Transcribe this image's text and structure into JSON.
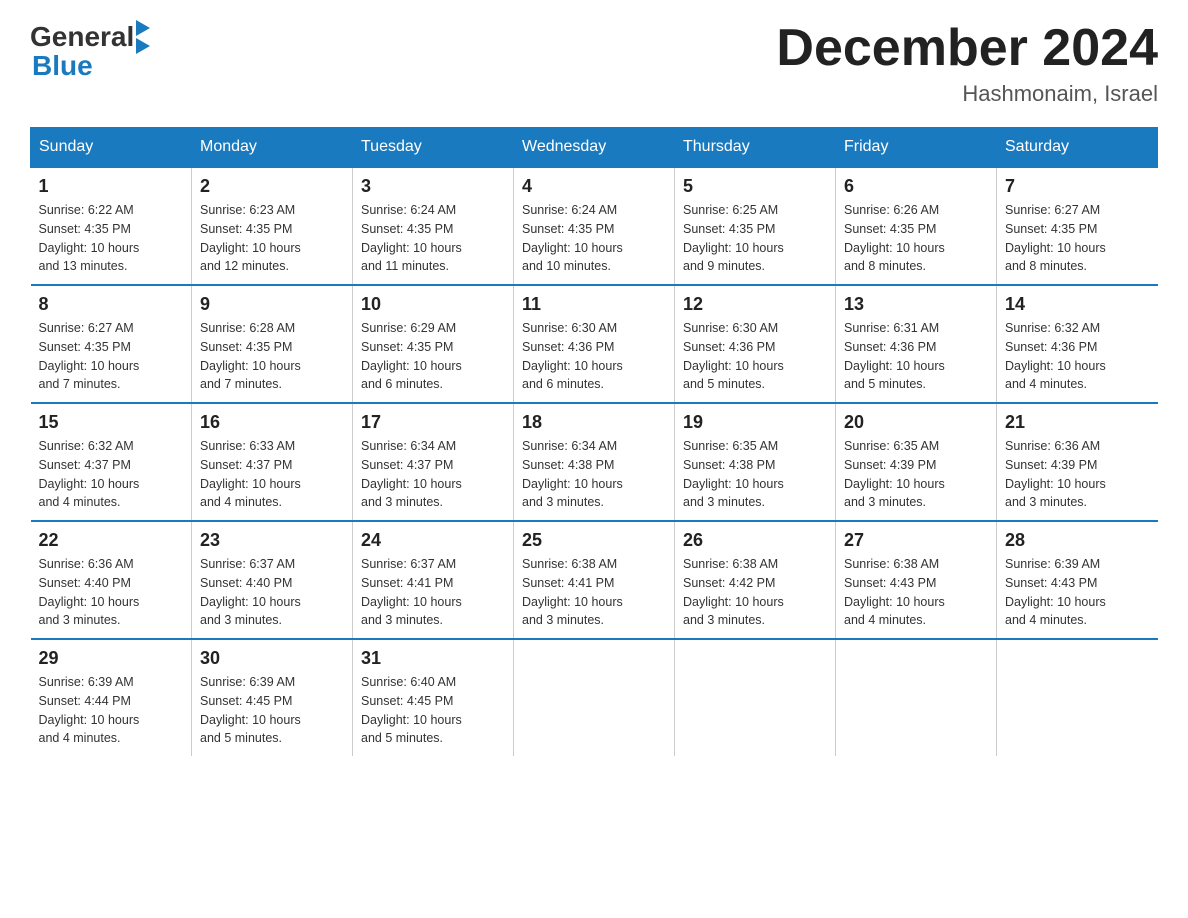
{
  "logo": {
    "general": "General",
    "blue": "Blue"
  },
  "title": "December 2024",
  "location": "Hashmonaim, Israel",
  "days_of_week": [
    "Sunday",
    "Monday",
    "Tuesday",
    "Wednesday",
    "Thursday",
    "Friday",
    "Saturday"
  ],
  "weeks": [
    [
      {
        "day": "1",
        "sunrise": "6:22 AM",
        "sunset": "4:35 PM",
        "daylight": "10 hours and 13 minutes."
      },
      {
        "day": "2",
        "sunrise": "6:23 AM",
        "sunset": "4:35 PM",
        "daylight": "10 hours and 12 minutes."
      },
      {
        "day": "3",
        "sunrise": "6:24 AM",
        "sunset": "4:35 PM",
        "daylight": "10 hours and 11 minutes."
      },
      {
        "day": "4",
        "sunrise": "6:24 AM",
        "sunset": "4:35 PM",
        "daylight": "10 hours and 10 minutes."
      },
      {
        "day": "5",
        "sunrise": "6:25 AM",
        "sunset": "4:35 PM",
        "daylight": "10 hours and 9 minutes."
      },
      {
        "day": "6",
        "sunrise": "6:26 AM",
        "sunset": "4:35 PM",
        "daylight": "10 hours and 8 minutes."
      },
      {
        "day": "7",
        "sunrise": "6:27 AM",
        "sunset": "4:35 PM",
        "daylight": "10 hours and 8 minutes."
      }
    ],
    [
      {
        "day": "8",
        "sunrise": "6:27 AM",
        "sunset": "4:35 PM",
        "daylight": "10 hours and 7 minutes."
      },
      {
        "day": "9",
        "sunrise": "6:28 AM",
        "sunset": "4:35 PM",
        "daylight": "10 hours and 7 minutes."
      },
      {
        "day": "10",
        "sunrise": "6:29 AM",
        "sunset": "4:35 PM",
        "daylight": "10 hours and 6 minutes."
      },
      {
        "day": "11",
        "sunrise": "6:30 AM",
        "sunset": "4:36 PM",
        "daylight": "10 hours and 6 minutes."
      },
      {
        "day": "12",
        "sunrise": "6:30 AM",
        "sunset": "4:36 PM",
        "daylight": "10 hours and 5 minutes."
      },
      {
        "day": "13",
        "sunrise": "6:31 AM",
        "sunset": "4:36 PM",
        "daylight": "10 hours and 5 minutes."
      },
      {
        "day": "14",
        "sunrise": "6:32 AM",
        "sunset": "4:36 PM",
        "daylight": "10 hours and 4 minutes."
      }
    ],
    [
      {
        "day": "15",
        "sunrise": "6:32 AM",
        "sunset": "4:37 PM",
        "daylight": "10 hours and 4 minutes."
      },
      {
        "day": "16",
        "sunrise": "6:33 AM",
        "sunset": "4:37 PM",
        "daylight": "10 hours and 4 minutes."
      },
      {
        "day": "17",
        "sunrise": "6:34 AM",
        "sunset": "4:37 PM",
        "daylight": "10 hours and 3 minutes."
      },
      {
        "day": "18",
        "sunrise": "6:34 AM",
        "sunset": "4:38 PM",
        "daylight": "10 hours and 3 minutes."
      },
      {
        "day": "19",
        "sunrise": "6:35 AM",
        "sunset": "4:38 PM",
        "daylight": "10 hours and 3 minutes."
      },
      {
        "day": "20",
        "sunrise": "6:35 AM",
        "sunset": "4:39 PM",
        "daylight": "10 hours and 3 minutes."
      },
      {
        "day": "21",
        "sunrise": "6:36 AM",
        "sunset": "4:39 PM",
        "daylight": "10 hours and 3 minutes."
      }
    ],
    [
      {
        "day": "22",
        "sunrise": "6:36 AM",
        "sunset": "4:40 PM",
        "daylight": "10 hours and 3 minutes."
      },
      {
        "day": "23",
        "sunrise": "6:37 AM",
        "sunset": "4:40 PM",
        "daylight": "10 hours and 3 minutes."
      },
      {
        "day": "24",
        "sunrise": "6:37 AM",
        "sunset": "4:41 PM",
        "daylight": "10 hours and 3 minutes."
      },
      {
        "day": "25",
        "sunrise": "6:38 AM",
        "sunset": "4:41 PM",
        "daylight": "10 hours and 3 minutes."
      },
      {
        "day": "26",
        "sunrise": "6:38 AM",
        "sunset": "4:42 PM",
        "daylight": "10 hours and 3 minutes."
      },
      {
        "day": "27",
        "sunrise": "6:38 AM",
        "sunset": "4:43 PM",
        "daylight": "10 hours and 4 minutes."
      },
      {
        "day": "28",
        "sunrise": "6:39 AM",
        "sunset": "4:43 PM",
        "daylight": "10 hours and 4 minutes."
      }
    ],
    [
      {
        "day": "29",
        "sunrise": "6:39 AM",
        "sunset": "4:44 PM",
        "daylight": "10 hours and 4 minutes."
      },
      {
        "day": "30",
        "sunrise": "6:39 AM",
        "sunset": "4:45 PM",
        "daylight": "10 hours and 5 minutes."
      },
      {
        "day": "31",
        "sunrise": "6:40 AM",
        "sunset": "4:45 PM",
        "daylight": "10 hours and 5 minutes."
      },
      null,
      null,
      null,
      null
    ]
  ],
  "labels": {
    "sunrise": "Sunrise:",
    "sunset": "Sunset:",
    "daylight": "Daylight:"
  }
}
